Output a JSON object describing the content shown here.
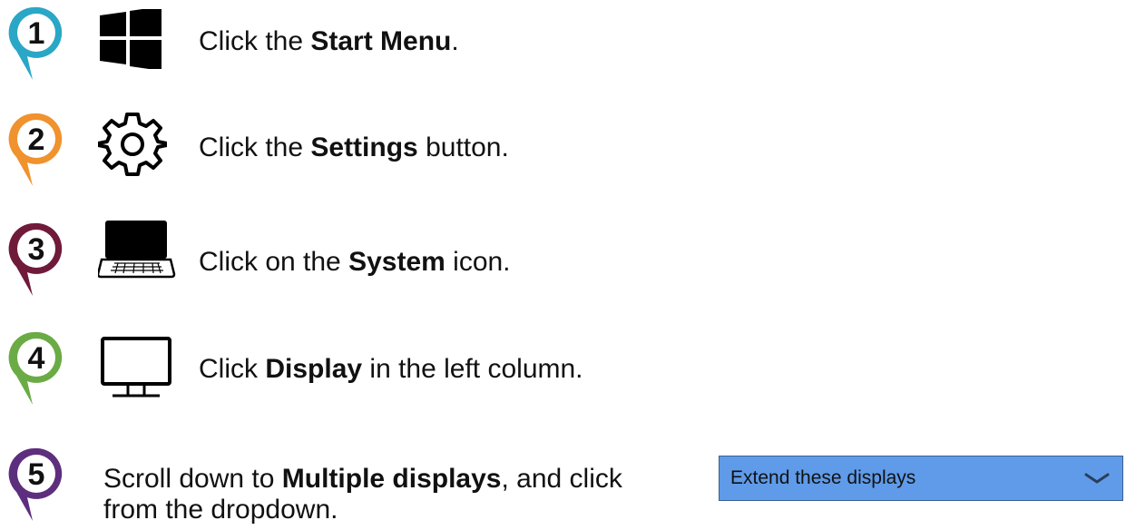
{
  "steps": [
    {
      "number": "1",
      "color": "#2aa7c6",
      "icon": "windows-logo-icon",
      "pre": "Click the ",
      "bold": "Start Menu",
      "post": "."
    },
    {
      "number": "2",
      "color": "#f0922e",
      "icon": "gear-icon",
      "pre": "Click the ",
      "bold": "Settings",
      "post": " button."
    },
    {
      "number": "3",
      "color": "#701a3a",
      "icon": "laptop-icon",
      "pre": "Click on the ",
      "bold": "System",
      "post": " icon."
    },
    {
      "number": "4",
      "color": "#6aab45",
      "icon": "monitor-icon",
      "pre": "Click ",
      "bold": "Display",
      "post": " in the left column."
    },
    {
      "number": "5",
      "color": "#5d2e7e",
      "icon": "",
      "pre": "Scroll down to ",
      "bold": "Multiple displays",
      "post": ", and click",
      "line2": "from the dropdown."
    }
  ],
  "dropdown": {
    "selected": "Extend these displays",
    "icon": "chevron-down-icon",
    "background": "#5f9be9"
  }
}
